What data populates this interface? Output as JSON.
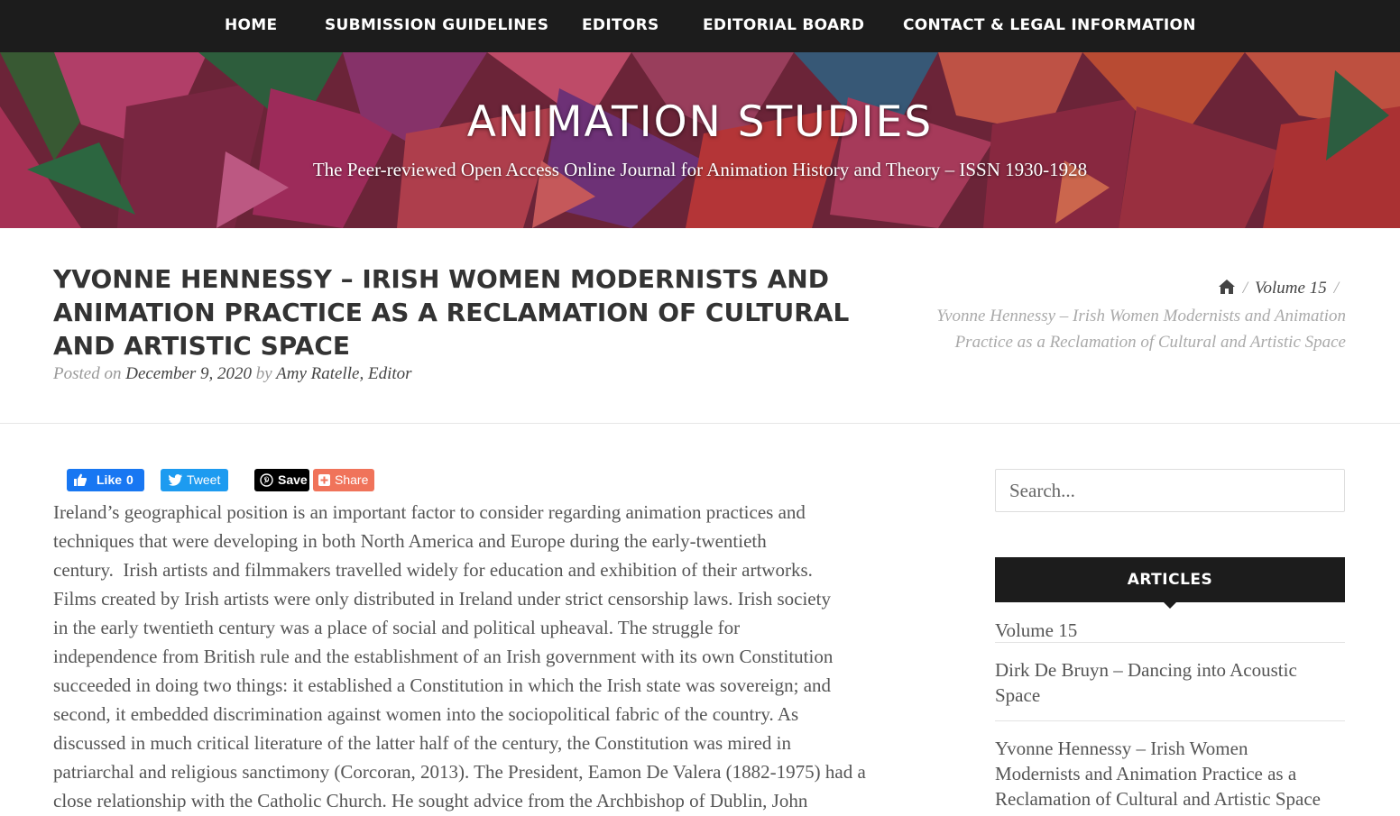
{
  "nav": {
    "items": [
      "HOME",
      "SUBMISSION GUIDELINES",
      "EDITORS",
      "EDITORIAL BOARD",
      "CONTACT & LEGAL INFORMATION"
    ]
  },
  "hero": {
    "title": "ANIMATION STUDIES",
    "tagline": "The Peer-reviewed Open Access Online Journal for Animation History and Theory – ISSN 1930-1928"
  },
  "post": {
    "title": "YVONNE HENNESSY – IRISH WOMEN MODERNISTS AND ANIMATION PRACTICE AS A RECLAMATION OF CULTURAL AND ARTISTIC SPACE",
    "posted_on": "Posted on",
    "date": "December 9, 2020",
    "by": "by",
    "author": "Amy Ratelle, Editor"
  },
  "breadcrumb": {
    "home_icon": "home-icon",
    "separator": "/",
    "volume": "Volume 15",
    "current": "Yvonne Hennessy – Irish Women Modernists and Animation Practice as a Reclamation of Cultural and Artistic Space"
  },
  "share": {
    "like": "Like",
    "like_count": "0",
    "tweet": "Tweet",
    "save": "Save",
    "share": "Share"
  },
  "article": {
    "lines": [
      "Ireland’s geographical position is an important factor to consider regarding animation practices and",
      "techniques that were developing in both North America and Europe during the early-twentieth",
      "century.  Irish artists and filmmakers travelled widely for education and exhibition of their artworks.",
      "Films created by Irish artists were only distributed in Ireland under strict censorship laws. Irish society",
      "in the early twentieth century was a place of social and political upheaval. The struggle for",
      "independence from British rule and the establishment of an Irish government with its own Constitution",
      "succeeded in doing two things: it established a Constitution in which the Irish state was sovereign; and",
      "second, it embedded discrimination against women into the sociopolitical fabric of the country. As",
      "discussed in much critical literature of the latter half of the century, the Constitution was mired in",
      "patriarchal and religious sanctimony (Corcoran, 2013). The President, Eamon De Valera (1882-1975) had a",
      "close relationship with the Catholic Church. He sought advice from the Archbishop of Dublin, John"
    ]
  },
  "sidebar": {
    "search_placeholder": "Search...",
    "widget_title": "ARTICLES",
    "articles": [
      [
        "Volume 15"
      ],
      [
        "Dirk De Bruyn – Dancing into Acoustic",
        "Space"
      ],
      [
        "Yvonne Hennessy – Irish Women",
        "Modernists and Animation Practice as a",
        "Reclamation of Cultural and Artistic Space"
      ]
    ]
  },
  "colors": {
    "nav_bg": "#1c1c1c",
    "facebook": "#1877f2",
    "twitter": "#1d9bf0",
    "pinterest": "#000000",
    "share": "#f0735a"
  }
}
